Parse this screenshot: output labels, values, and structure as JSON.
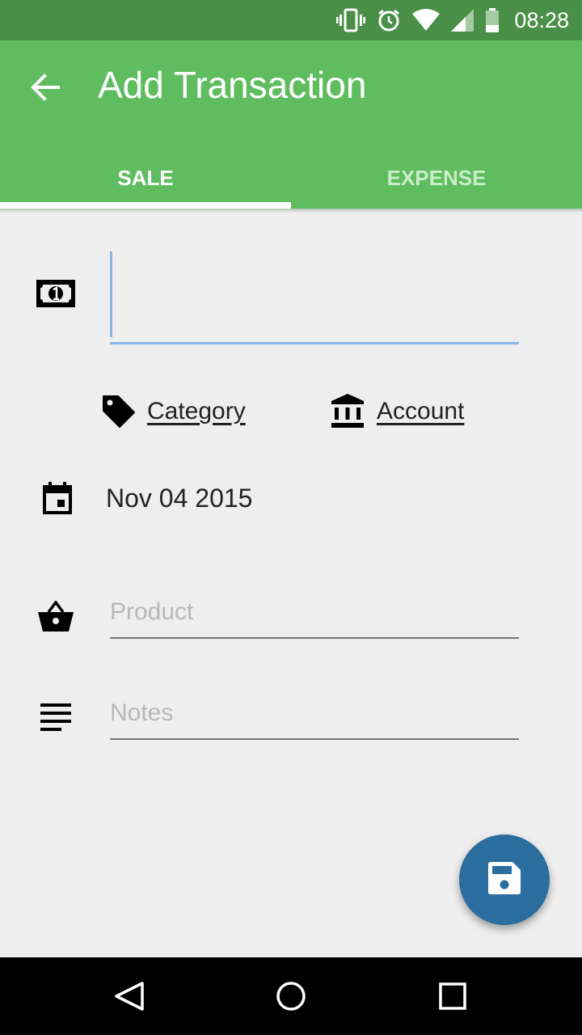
{
  "status_bar": {
    "time": "08:28"
  },
  "app_bar": {
    "title": "Add Transaction",
    "back_icon": "arrow-back-icon"
  },
  "tabs": [
    {
      "label": "SALE",
      "active": true
    },
    {
      "label": "EXPENSE",
      "active": false
    }
  ],
  "form": {
    "amount": {
      "icon": "money-icon",
      "value": ""
    },
    "category": {
      "icon": "tag-icon",
      "label": "Category"
    },
    "account": {
      "icon": "bank-icon",
      "label": "Account"
    },
    "date": {
      "icon": "calendar-icon",
      "value": "Nov 04 2015"
    },
    "product": {
      "icon": "basket-icon",
      "placeholder": "Product",
      "value": ""
    },
    "notes": {
      "icon": "notes-icon",
      "placeholder": "Notes",
      "value": ""
    }
  },
  "fab": {
    "icon": "save-icon"
  },
  "navigation": [
    "back-icon",
    "home-icon",
    "recents-icon"
  ],
  "colors": {
    "status_bar": "#4a8f47",
    "app_bar": "#5fbd5f",
    "input_focus": "#8ab4ea",
    "fab": "#2c6d9f",
    "background": "#eeeeee"
  }
}
